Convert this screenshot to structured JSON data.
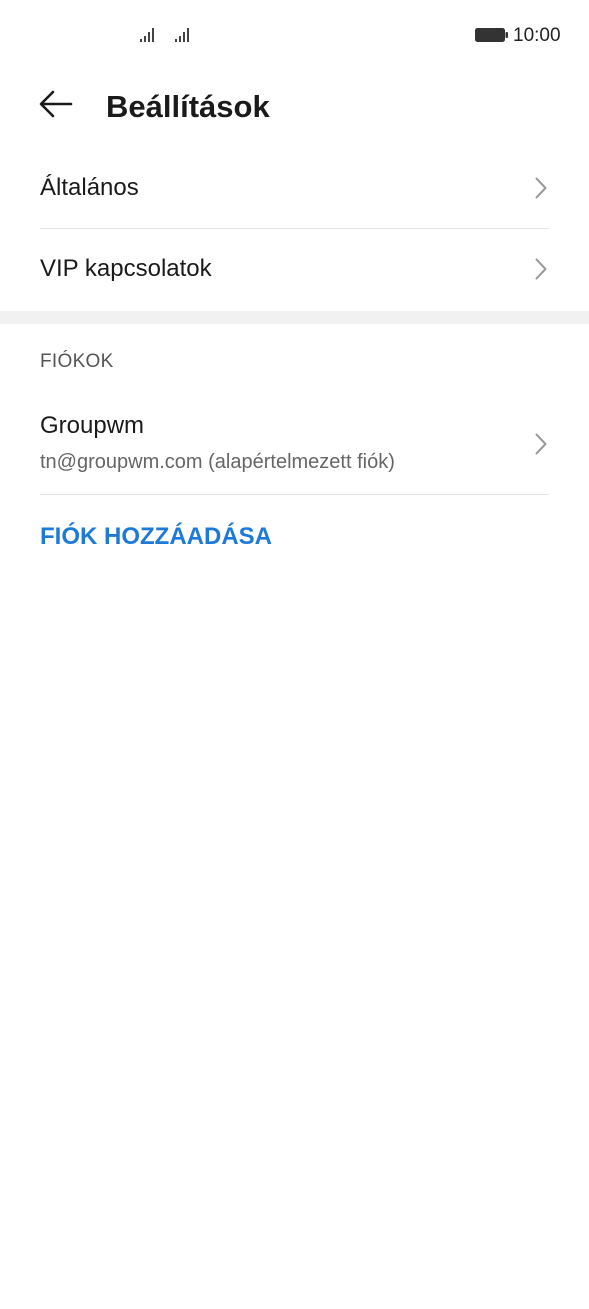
{
  "status_bar": {
    "time": "10:00",
    "icons": [
      "signal-icon",
      "signal-icon",
      "battery-icon"
    ]
  },
  "header": {
    "title": "Beállítások",
    "back_icon": "arrow-left-icon"
  },
  "settings": {
    "items": [
      {
        "label": "Általános",
        "icon": "chevron-right-icon"
      },
      {
        "label": "VIP kapcsolatok",
        "icon": "chevron-right-icon"
      }
    ]
  },
  "accounts": {
    "section_title": "FIÓKOK",
    "items": [
      {
        "name": "Groupwm",
        "email": "tn@groupwm.com (alapértelmezett fiók)",
        "icon": "chevron-right-icon"
      }
    ],
    "add_label": "FIÓK HOZZÁADÁSA"
  },
  "colors": {
    "accent": "#1e7ad8",
    "text_primary": "#1a1a1a",
    "text_secondary": "#666666",
    "divider": "#e4e4e4",
    "section_gap": "#f1f1f1"
  }
}
